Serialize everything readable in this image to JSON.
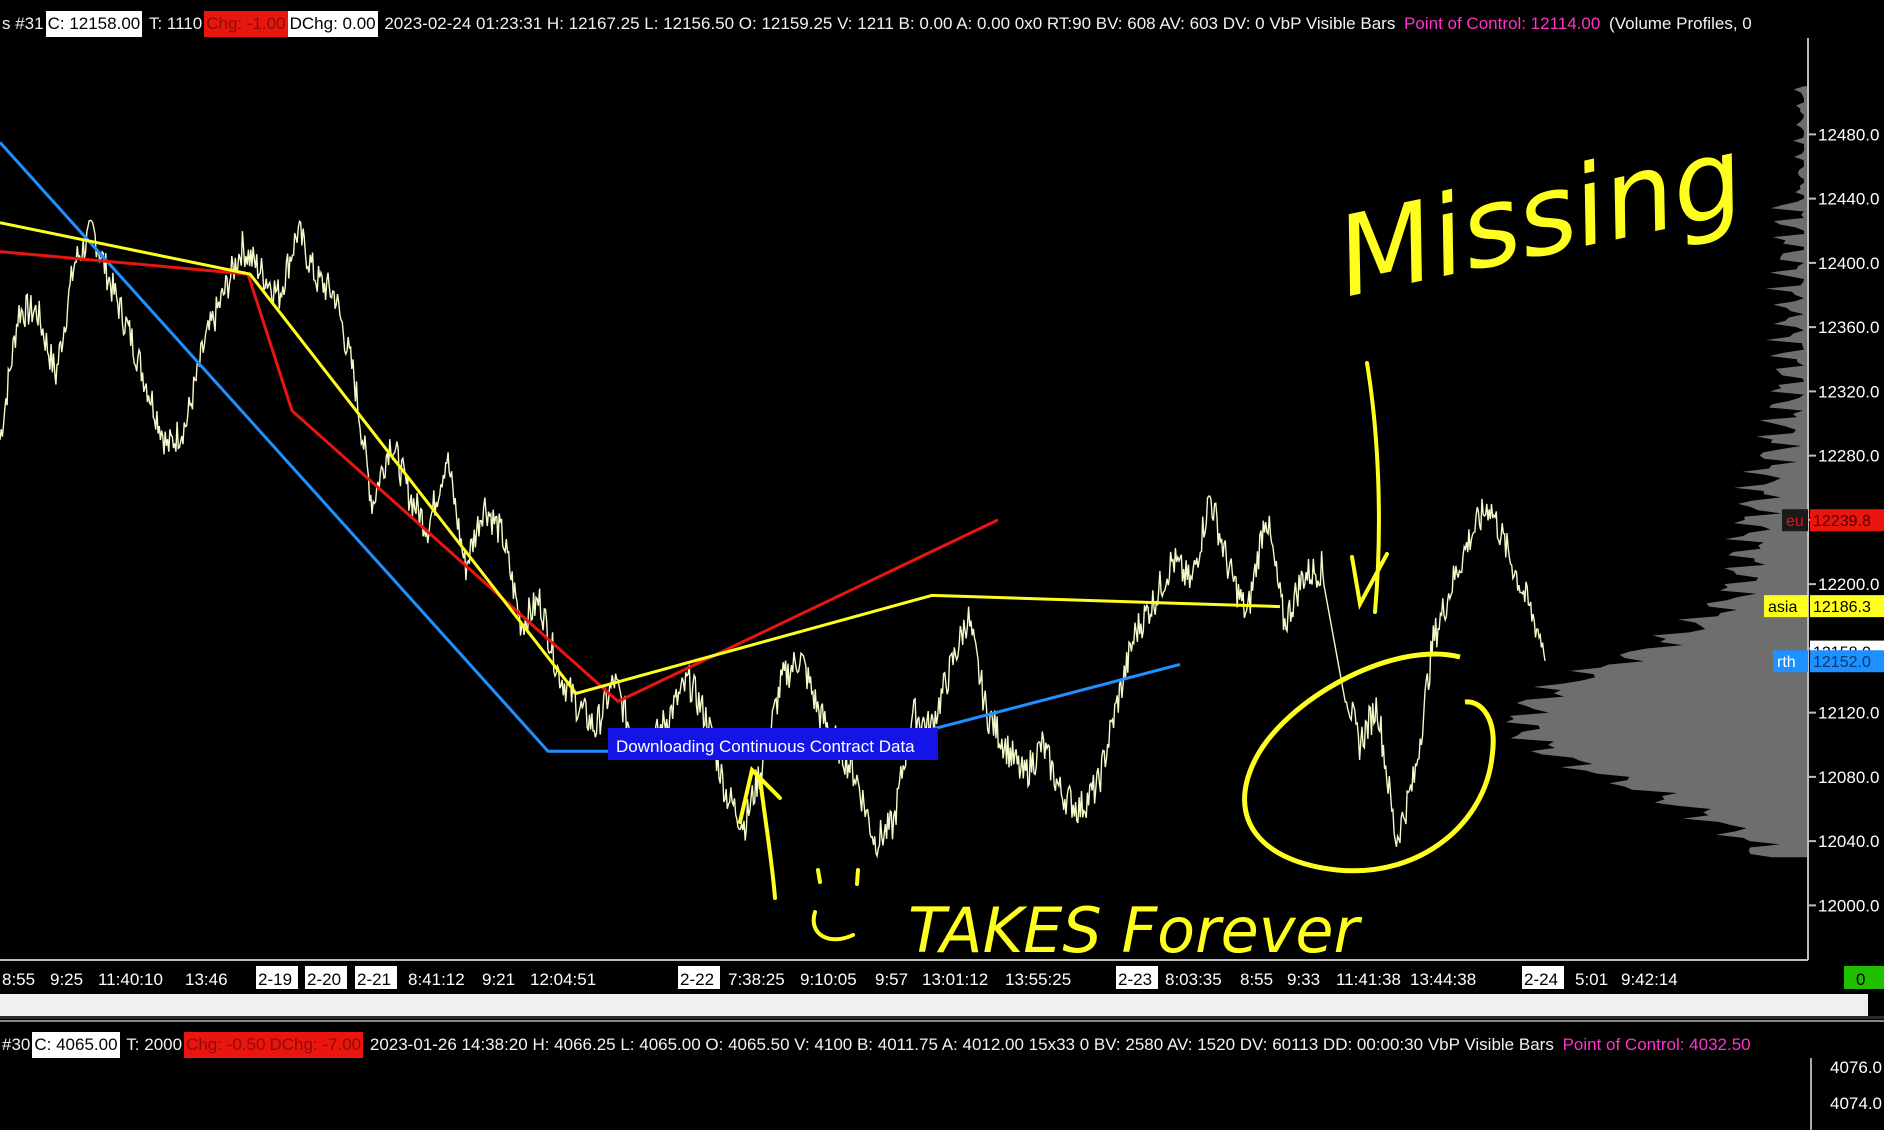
{
  "header": {
    "prefix": "s #31",
    "close": "C: 12158.00",
    "ticks": "T: 1110",
    "chg": "Chg: -1.00",
    "dchg": "DChg: 0.00",
    "stats": "2023-02-24 01:23:31 H: 12167.25 L: 12156.50 O: 12159.25 V: 1211 B: 0.00 A: 0.00 0x0 RT:90 BV: 608 AV: 603 DV: 0 VbP Visible Bars",
    "poc": "Point of Control: 12114.00",
    "vp": "(Volume Profiles, 0"
  },
  "chart_data": {
    "type": "line",
    "title": "",
    "y_axis_ticks": [
      "12480.0",
      "12440.0",
      "12400.0",
      "12360.0",
      "12320.0",
      "12280.0",
      "12240.0",
      "12200.0",
      "12160.0",
      "12120.0",
      "12080.0",
      "12040.0",
      "12000.0"
    ],
    "ylim": [
      11966,
      12540
    ],
    "x_labels": [
      {
        "text": "8:55",
        "boxed": false
      },
      {
        "text": "9:25",
        "boxed": false
      },
      {
        "text": "11:40:10",
        "boxed": false
      },
      {
        "text": "13:46",
        "boxed": false
      },
      {
        "text": "2-19",
        "boxed": true
      },
      {
        "text": "2-20",
        "boxed": true
      },
      {
        "text": "2-21",
        "boxed": true
      },
      {
        "text": "8:41:12",
        "boxed": false
      },
      {
        "text": "9:21",
        "boxed": false
      },
      {
        "text": "12:04:51",
        "boxed": false
      },
      {
        "text": "2-22",
        "boxed": true
      },
      {
        "text": "7:38:25",
        "boxed": false
      },
      {
        "text": "9:10:05",
        "boxed": false
      },
      {
        "text": "9:57",
        "boxed": false
      },
      {
        "text": "13:01:12",
        "boxed": false
      },
      {
        "text": "13:55:25",
        "boxed": false
      },
      {
        "text": "2-23",
        "boxed": true
      },
      {
        "text": "8:03:35",
        "boxed": false
      },
      {
        "text": "8:55",
        "boxed": false
      },
      {
        "text": "9:33",
        "boxed": false
      },
      {
        "text": "11:41:38",
        "boxed": false
      },
      {
        "text": "13:44:38",
        "boxed": false
      },
      {
        "text": "2-24",
        "boxed": true
      },
      {
        "text": "5:01",
        "boxed": false
      },
      {
        "text": "9:42:14",
        "boxed": false
      }
    ],
    "price_path": [
      12290,
      12370,
      12370,
      12330,
      12400,
      12420,
      12385,
      12355,
      12320,
      12285,
      12300,
      12350,
      12380,
      12410,
      12395,
      12380,
      12420,
      12390,
      12380,
      12330,
      12250,
      12290,
      12255,
      12235,
      12280,
      12210,
      12250,
      12230,
      12175,
      12190,
      12145,
      12125,
      12110,
      12140,
      12105,
      12100,
      12120,
      12140,
      12115,
      12070,
      12050,
      12090,
      12140,
      12155,
      12120,
      12100,
      12080,
      12040,
      12050,
      12120,
      12110,
      12145,
      12180,
      12120,
      12100,
      12080,
      12100,
      12070,
      12060,
      12075,
      12125,
      12170,
      12190,
      12215,
      12200,
      12255,
      12210,
      12180,
      12245,
      12175,
      12205,
      12210,
      12150,
      12100,
      12125,
      12040,
      12080,
      12165,
      12200,
      12230,
      12250,
      12220,
      12190,
      12160
    ],
    "price_color": "#f4f9c9",
    "trend_lines": [
      {
        "color": "#1e90ff",
        "points": [
          [
            0,
            12475
          ],
          [
            548,
            12096
          ],
          [
            848,
            12096
          ],
          [
            1180,
            12150
          ]
        ]
      },
      {
        "color": "#e8160f",
        "points": [
          [
            0,
            12407
          ],
          [
            248,
            12393
          ],
          [
            292,
            12308
          ],
          [
            618,
            12127
          ],
          [
            998,
            12240
          ]
        ]
      },
      {
        "color": "#ffff1f",
        "points": [
          [
            0,
            12425
          ],
          [
            250,
            12393
          ],
          [
            576,
            12132
          ],
          [
            932,
            12193
          ],
          [
            1280,
            12186
          ]
        ]
      }
    ],
    "price_tags": [
      {
        "label": "eu",
        "value": "12239.8",
        "bg": "#e8160f",
        "label_bg": "#1a1a1a",
        "label_color": "#e8160f",
        "color": "#4d0000"
      },
      {
        "label": "asia",
        "value": "12186.3",
        "bg": "#ffff1f",
        "label_bg": "#ffff1f",
        "label_color": "#000000",
        "color": "#000000"
      },
      {
        "label": "",
        "value": "12158.0",
        "bg": "#ffffff",
        "label_bg": "#000000",
        "label_color": "#000000",
        "color": "#000000"
      },
      {
        "label": "rth",
        "value": "12152.0",
        "bg": "#1e90ff",
        "label_bg": "#1e90ff",
        "label_color": "#ffffff",
        "color": "#0a3a73"
      }
    ],
    "volume_profile": {
      "color": "#6e6e6e",
      "poc": 12114
    },
    "status_banner": "Downloading Continuous Contract Data",
    "annotations": {
      "missing_text": "Missing",
      "forever_text": "TAKES Forever",
      "color": "#ffff1f"
    },
    "corner_value": "0"
  },
  "panel2": {
    "header": {
      "prefix": "#30",
      "close": "C: 4065.00",
      "ticks": "T: 2000",
      "chg": "Chg: -0.50",
      "dchg": "DChg: -7.00",
      "stats": "2023-01-26 14:38:20 H: 4066.25 L: 4065.00 O: 4065.50 V: 4100 B: 4011.75 A: 4012.00 15x33 0 BV: 2580 AV: 1520 DV: 60113 DD: 00:00:30 VbP Visible Bars",
      "poc": "Point of Control: 4032.50"
    },
    "y_ticks": [
      "4076.0",
      "4074.0"
    ]
  }
}
